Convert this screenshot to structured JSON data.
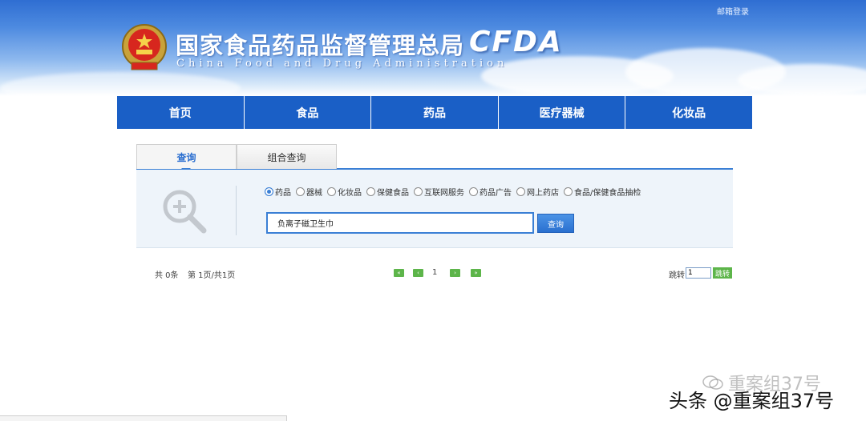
{
  "header": {
    "login_link": "邮箱登录",
    "title_cn": "国家食品药品监督管理总局",
    "title_en": "China Food and Drug Administration",
    "logo": "CFDA"
  },
  "nav": {
    "items": [
      "首页",
      "食品",
      "药品",
      "医疗器械",
      "化妆品"
    ]
  },
  "tabs": {
    "query": "查询",
    "combined_query": "组合查询"
  },
  "search": {
    "categories": [
      {
        "label": "药品",
        "checked": true
      },
      {
        "label": "器械",
        "checked": false
      },
      {
        "label": "化妆品",
        "checked": false
      },
      {
        "label": "保健食品",
        "checked": false
      },
      {
        "label": "互联网服务",
        "checked": false
      },
      {
        "label": "药品广告",
        "checked": false
      },
      {
        "label": "网上药店",
        "checked": false
      },
      {
        "label": "食品/保健食品抽检",
        "checked": false
      }
    ],
    "input_value": "负离子磁卫生巾",
    "button_label": "查询"
  },
  "pagination": {
    "total": "共 0条",
    "page_info": "第 1页/共1页",
    "first": "«",
    "prev": "‹",
    "current_page": "1",
    "next": "›",
    "last": "»",
    "jump_label": "跳转",
    "jump_value": "1",
    "jump_button": "跳转"
  },
  "watermark": {
    "top_text": "重案组37号",
    "bottom_text": "头条 @重案组37号"
  },
  "colors": {
    "nav_blue": "#1a5fc6",
    "accent_blue": "#3a7fd5",
    "pager_green": "#5db54a"
  }
}
